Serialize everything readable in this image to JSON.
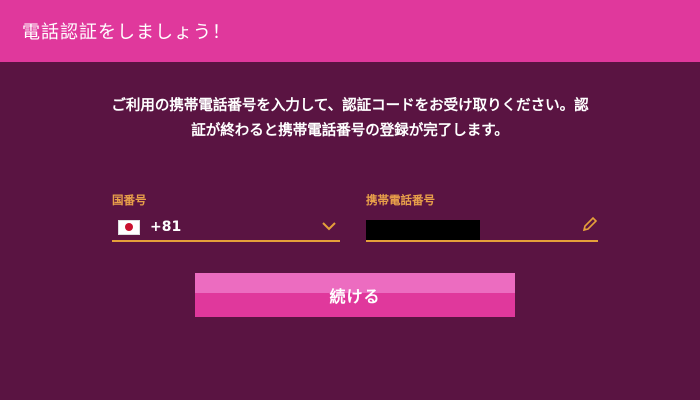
{
  "header": {
    "title": "電話認証をしましょう！"
  },
  "instructions": {
    "text": "ご利用の携帯電話番号を入力して、認証コードをお受け取りください。認証が終わると携帯電話番号の登録が完了します。"
  },
  "form": {
    "country_label": "国番号",
    "country_code": "+81",
    "country_flag": "japan-flag",
    "phone_label": "携帯電話番号",
    "phone_value": ""
  },
  "buttons": {
    "continue_label": "続ける"
  },
  "colors": {
    "background": "#5a1442",
    "header": "#e0389c",
    "accent": "#e5a03a",
    "button": "#e0389c"
  }
}
